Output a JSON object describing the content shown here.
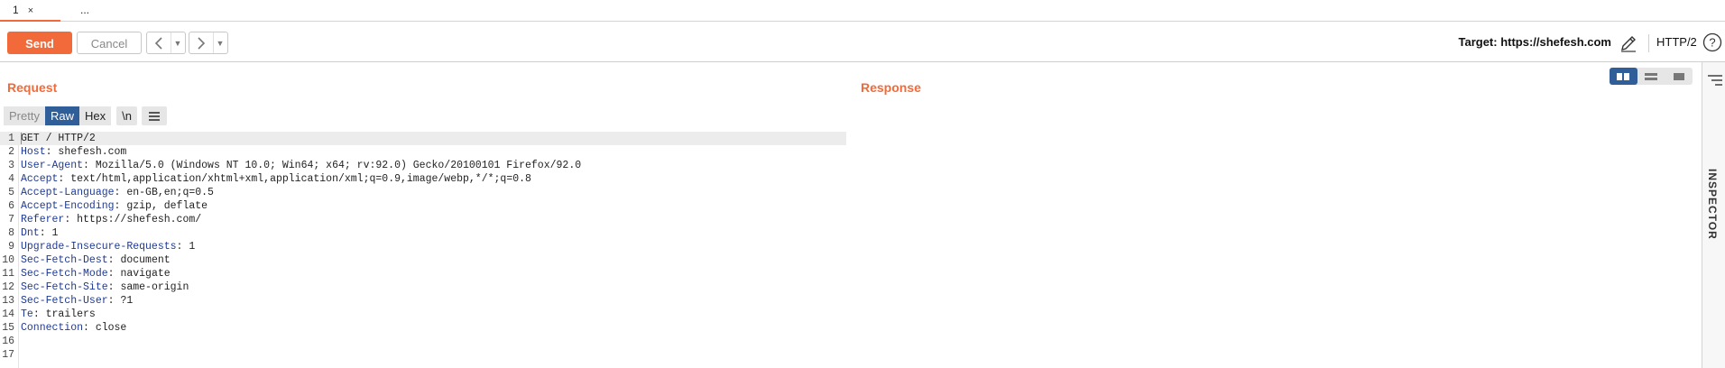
{
  "tabs": [
    {
      "label": "1",
      "close": "×"
    },
    {
      "label": "..."
    }
  ],
  "toolbar": {
    "send_label": "Send",
    "cancel_label": "Cancel",
    "target_label": "Target: https://shefesh.com",
    "protocol_label": "HTTP/2"
  },
  "request": {
    "title": "Request",
    "editor_tabs": {
      "pretty": "Pretty",
      "raw": "Raw",
      "hex": "Hex",
      "newline": "\\n"
    },
    "lines": [
      {
        "n": "1",
        "key": "GET / HTTP/2",
        "sep": "",
        "value": ""
      },
      {
        "n": "2",
        "key": "Host",
        "sep": ": ",
        "value": "shefesh.com"
      },
      {
        "n": "3",
        "key": "User-Agent",
        "sep": ": ",
        "value": "Mozilla/5.0 (Windows NT 10.0; Win64; x64; rv:92.0) Gecko/20100101 Firefox/92.0"
      },
      {
        "n": "4",
        "key": "Accept",
        "sep": ": ",
        "value": "text/html,application/xhtml+xml,application/xml;q=0.9,image/webp,*/*;q=0.8"
      },
      {
        "n": "5",
        "key": "Accept-Language",
        "sep": ": ",
        "value": "en-GB,en;q=0.5"
      },
      {
        "n": "6",
        "key": "Accept-Encoding",
        "sep": ": ",
        "value": "gzip, deflate"
      },
      {
        "n": "7",
        "key": "Referer",
        "sep": ": ",
        "value": "https://shefesh.com/"
      },
      {
        "n": "8",
        "key": "Dnt",
        "sep": ": ",
        "value": "1"
      },
      {
        "n": "9",
        "key": "Upgrade-Insecure-Requests",
        "sep": ": ",
        "value": "1"
      },
      {
        "n": "10",
        "key": "Sec-Fetch-Dest",
        "sep": ": ",
        "value": "document"
      },
      {
        "n": "11",
        "key": "Sec-Fetch-Mode",
        "sep": ": ",
        "value": "navigate"
      },
      {
        "n": "12",
        "key": "Sec-Fetch-Site",
        "sep": ": ",
        "value": "same-origin"
      },
      {
        "n": "13",
        "key": "Sec-Fetch-User",
        "sep": ": ",
        "value": "?1"
      },
      {
        "n": "14",
        "key": "Te",
        "sep": ": ",
        "value": "trailers"
      },
      {
        "n": "15",
        "key": "Connection",
        "sep": ": ",
        "value": "close"
      },
      {
        "n": "16",
        "key": "",
        "sep": "",
        "value": ""
      },
      {
        "n": "17",
        "key": "",
        "sep": "",
        "value": ""
      }
    ]
  },
  "response": {
    "title": "Response"
  },
  "inspector": {
    "label": "INSPECTOR"
  },
  "colors": {
    "accent": "#f26a3a",
    "selected_tab": "#2f5e98",
    "header_key": "#1f3a93"
  },
  "icons": [
    "back-arrow-icon",
    "forward-arrow-icon",
    "dropdown-icon",
    "edit-pencil-icon",
    "help-icon",
    "menu-icon",
    "split-horizontal-icon",
    "split-vertical-icon",
    "single-panel-icon",
    "inspector-icon"
  ]
}
